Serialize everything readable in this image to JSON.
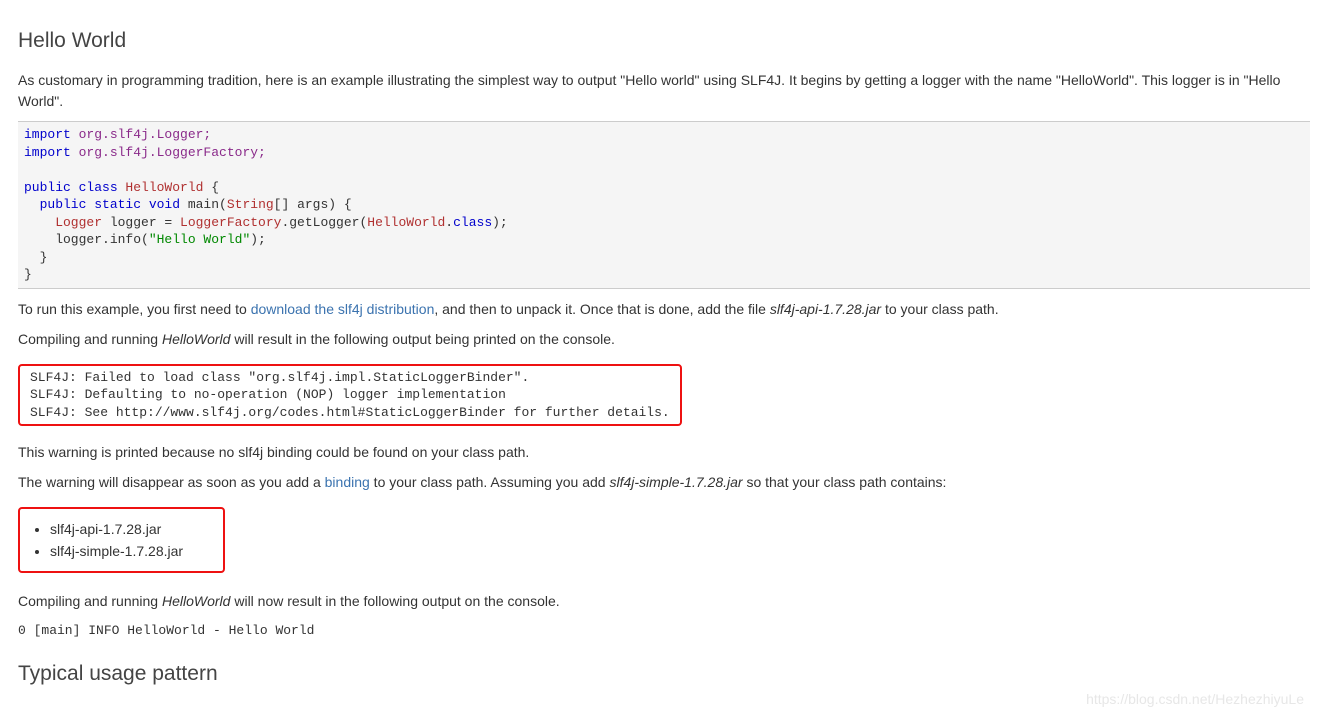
{
  "section1_title": "Hello World",
  "intro": "As customary in programming tradition, here is an example illustrating the simplest way to output \"Hello world\" using SLF4J. It begins by getting a logger with the name \"HelloWorld\". This logger is in \"Hello World\".",
  "code": {
    "l1a": "import",
    "l1b": " org.slf4j.Logger;",
    "l2a": "import",
    "l2b": " org.slf4j.LoggerFactory;",
    "l3a": "public class ",
    "l3b": "HelloWorld",
    "l3c": " {",
    "l4a": "  public static void ",
    "l4b": "main",
    "l4c": "(",
    "l4d": "String",
    "l4e": "[] args) {",
    "l5a": "    Logger",
    "l5b": " logger = ",
    "l5c": "LoggerFactory",
    "l5d": ".getLogger(",
    "l5e": "HelloWorld",
    "l5f": ".",
    "l5g": "class",
    "l5h": ");",
    "l6a": "    logger.info(",
    "l6b": "\"Hello World\"",
    "l6c": ");",
    "l7": "  }",
    "l8": "}"
  },
  "run_pre": "To run this example, you first need to ",
  "run_link": "download the slf4j distribution",
  "run_mid": ", and then to unpack it. Once that is done, add the file ",
  "run_jar": "slf4j-api-1.7.28.jar",
  "run_post": " to your class path.",
  "compile1_pre": "Compiling and running ",
  "compile1_i": "HelloWorld",
  "compile1_post": " will result in the following output being printed on the console.",
  "output1": "SLF4J: Failed to load class \"org.slf4j.impl.StaticLoggerBinder\".\nSLF4J: Defaulting to no-operation (NOP) logger implementation\nSLF4J: See http://www.slf4j.org/codes.html#StaticLoggerBinder for further details.",
  "warn_reason": "This warning is printed because no slf4j binding could be found on your class path.",
  "warn2_pre": "The warning will disappear as soon as you add a ",
  "warn2_link": "binding",
  "warn2_mid": " to your class path. Assuming you add ",
  "warn2_i": "slf4j-simple-1.7.28.jar",
  "warn2_post": " so that your class path contains:",
  "jarlist": [
    "slf4j-api-1.7.28.jar",
    "slf4j-simple-1.7.28.jar"
  ],
  "compile2_pre": "Compiling and running ",
  "compile2_i": "HelloWorld",
  "compile2_post": " will now result in the following output on the console.",
  "output2": "0 [main] INFO HelloWorld - Hello World",
  "section2_title": "Typical usage pattern",
  "watermark": "https://blog.csdn.net/HezhezhiyuLe"
}
